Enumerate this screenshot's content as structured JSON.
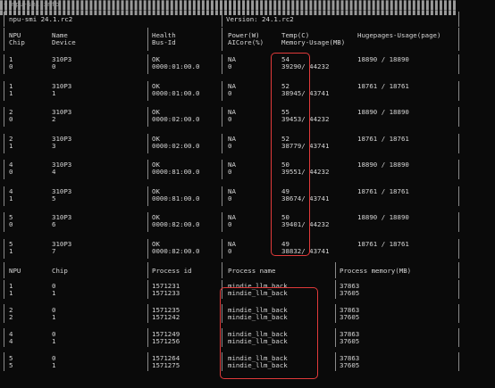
{
  "terminal": {
    "prompt_text": "~ npu-smi info",
    "header": {
      "title": "npu-smi 24.1.rc2",
      "version": "Version: 24.1.rc2"
    },
    "columns": {
      "c1a": "NPU",
      "c1b": "Chip",
      "c2a": "Name",
      "c2b": "Device",
      "c3a": "Health",
      "c3b": "Bus-Id",
      "c4a": "Power(W)",
      "c4b": "AICore(%)",
      "c5a": "Temp(C)",
      "c5b": "Memory-Usage(MB)",
      "c6a": "Hugepages-Usage(page)"
    },
    "npus": [
      {
        "npu": "1",
        "chip": "0",
        "name": "310P3",
        "device": "0",
        "health": "OK",
        "bus": "0000:01:00.0",
        "power": "NA",
        "aicore": "0",
        "temp": "54",
        "mem": "39290/ 44232",
        "huge": "18890 / 18890"
      },
      {
        "npu": "1",
        "chip": "1",
        "name": "310P3",
        "device": "1",
        "health": "OK",
        "bus": "0000:01:00.0",
        "power": "NA",
        "aicore": "0",
        "temp": "52",
        "mem": "38945/ 43741",
        "huge": "18761 / 18761"
      },
      {
        "npu": "2",
        "chip": "0",
        "name": "310P3",
        "device": "2",
        "health": "OK",
        "bus": "0000:02:00.0",
        "power": "NA",
        "aicore": "0",
        "temp": "55",
        "mem": "39453/ 44232",
        "huge": "18890 / 18890"
      },
      {
        "npu": "2",
        "chip": "1",
        "name": "310P3",
        "device": "3",
        "health": "OK",
        "bus": "0000:02:00.0",
        "power": "NA",
        "aicore": "0",
        "temp": "52",
        "mem": "38779/ 43741",
        "huge": "18761 / 18761"
      },
      {
        "npu": "4",
        "chip": "0",
        "name": "310P3",
        "device": "4",
        "health": "OK",
        "bus": "0000:81:00.0",
        "power": "NA",
        "aicore": "0",
        "temp": "50",
        "mem": "39551/ 44232",
        "huge": "18890 / 18890"
      },
      {
        "npu": "4",
        "chip": "1",
        "name": "310P3",
        "device": "5",
        "health": "OK",
        "bus": "0000:81:00.0",
        "power": "NA",
        "aicore": "0",
        "temp": "49",
        "mem": "38674/ 43741",
        "huge": "18761 / 18761"
      },
      {
        "npu": "5",
        "chip": "0",
        "name": "310P3",
        "device": "6",
        "health": "OK",
        "bus": "0000:82:00.0",
        "power": "NA",
        "aicore": "0",
        "temp": "50",
        "mem": "39401/ 44232",
        "huge": "18890 / 18890"
      },
      {
        "npu": "5",
        "chip": "1",
        "name": "310P3",
        "device": "7",
        "health": "OK",
        "bus": "0000:82:00.0",
        "power": "NA",
        "aicore": "0",
        "temp": "49",
        "mem": "38832/ 43741",
        "huge": "18761 / 18761"
      }
    ],
    "process_columns": {
      "npu": "NPU",
      "chip": "Chip",
      "pid": "Process id",
      "pname": "Process name",
      "pmem": "Process memory(MB)"
    },
    "processes": [
      [
        {
          "npu": "1",
          "chip": "0",
          "pid": "1571231",
          "pname": "mindie_llm_back",
          "pmem": "37863"
        },
        {
          "npu": "1",
          "chip": "1",
          "pid": "1571233",
          "pname": "mindie_llm_back",
          "pmem": "37605"
        }
      ],
      [
        {
          "npu": "2",
          "chip": "0",
          "pid": "1571235",
          "pname": "mindie_llm_back",
          "pmem": "37863"
        },
        {
          "npu": "2",
          "chip": "1",
          "pid": "1571242",
          "pname": "mindie_llm_back",
          "pmem": "37605"
        }
      ],
      [
        {
          "npu": "4",
          "chip": "0",
          "pid": "1571249",
          "pname": "mindie_llm_back",
          "pmem": "37863"
        },
        {
          "npu": "4",
          "chip": "1",
          "pid": "1571256",
          "pname": "mindie_llm_back",
          "pmem": "37605"
        }
      ],
      [
        {
          "npu": "5",
          "chip": "0",
          "pid": "1571264",
          "pname": "mindie_llm_back",
          "pmem": "37863"
        },
        {
          "npu": "5",
          "chip": "1",
          "pid": "1571275",
          "pname": "mindie_llm_back",
          "pmem": "37605"
        }
      ]
    ],
    "colors": {
      "highlight": "#e03a3a",
      "background": "#0a0a0a",
      "text": "#d6d6d6"
    }
  }
}
